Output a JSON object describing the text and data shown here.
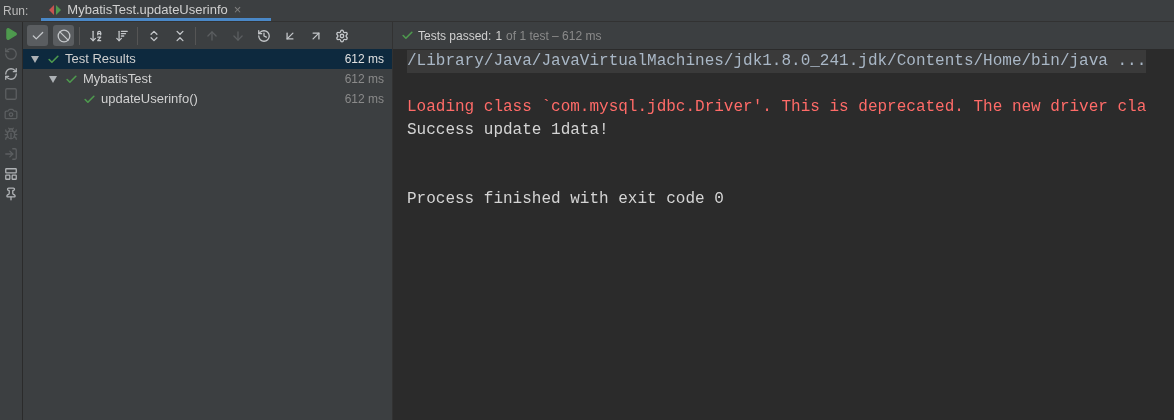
{
  "run_label": "Run:",
  "tab": {
    "title": "MybatisTest.updateUserinfo",
    "close": "×"
  },
  "side_tools": [
    {
      "kind": "run",
      "disabled": false
    },
    {
      "kind": "rerun-failed",
      "disabled": true
    },
    {
      "kind": "auto",
      "disabled": false
    },
    {
      "kind": "stop",
      "disabled": true
    },
    {
      "kind": "camera",
      "disabled": true
    },
    {
      "kind": "bug",
      "disabled": true
    },
    {
      "kind": "exit",
      "disabled": true
    },
    {
      "kind": "layout",
      "disabled": false
    },
    {
      "kind": "pin",
      "disabled": false
    }
  ],
  "toolbar": [
    {
      "kind": "passed",
      "selected": true,
      "disabled": false
    },
    {
      "kind": "ignored",
      "selected": true,
      "disabled": false
    },
    {
      "kind": "sort-alpha",
      "selected": false,
      "disabled": false
    },
    {
      "kind": "sort-duration",
      "selected": false,
      "disabled": false
    },
    {
      "kind": "expand",
      "selected": false,
      "disabled": false
    },
    {
      "kind": "collapse",
      "selected": false,
      "disabled": false
    },
    {
      "kind": "up",
      "selected": false,
      "disabled": true
    },
    {
      "kind": "down",
      "selected": false,
      "disabled": true
    },
    {
      "kind": "history",
      "selected": false,
      "disabled": false
    },
    {
      "kind": "import",
      "selected": false,
      "disabled": false
    },
    {
      "kind": "export",
      "selected": false,
      "disabled": false
    },
    {
      "kind": "settings",
      "selected": false,
      "disabled": false
    }
  ],
  "status": {
    "label": "Tests passed:",
    "count": "1",
    "detail": "of 1 test – 612 ms"
  },
  "tree": [
    {
      "name": "Test Results",
      "time": "612 ms",
      "selected": true,
      "expanded": true,
      "children": [
        {
          "name": "MybatisTest",
          "time": "612 ms",
          "selected": false,
          "expanded": true,
          "children": [
            {
              "name": "updateUserinfo()",
              "time": "612 ms",
              "selected": false
            }
          ]
        }
      ]
    }
  ],
  "console": [
    {
      "kind": "command",
      "text": "/Library/Java/JavaVirtualMachines/jdk1.8.0_241.jdk/Contents/Home/bin/java ..."
    },
    {
      "kind": "blank"
    },
    {
      "kind": "error",
      "text": "Loading class `com.mysql.jdbc.Driver'. This is deprecated. The new driver cla"
    },
    {
      "kind": "normal",
      "text": "Success update 1data!"
    },
    {
      "kind": "blank"
    },
    {
      "kind": "blank"
    },
    {
      "kind": "normal",
      "text": "Process finished with exit code 0"
    }
  ]
}
